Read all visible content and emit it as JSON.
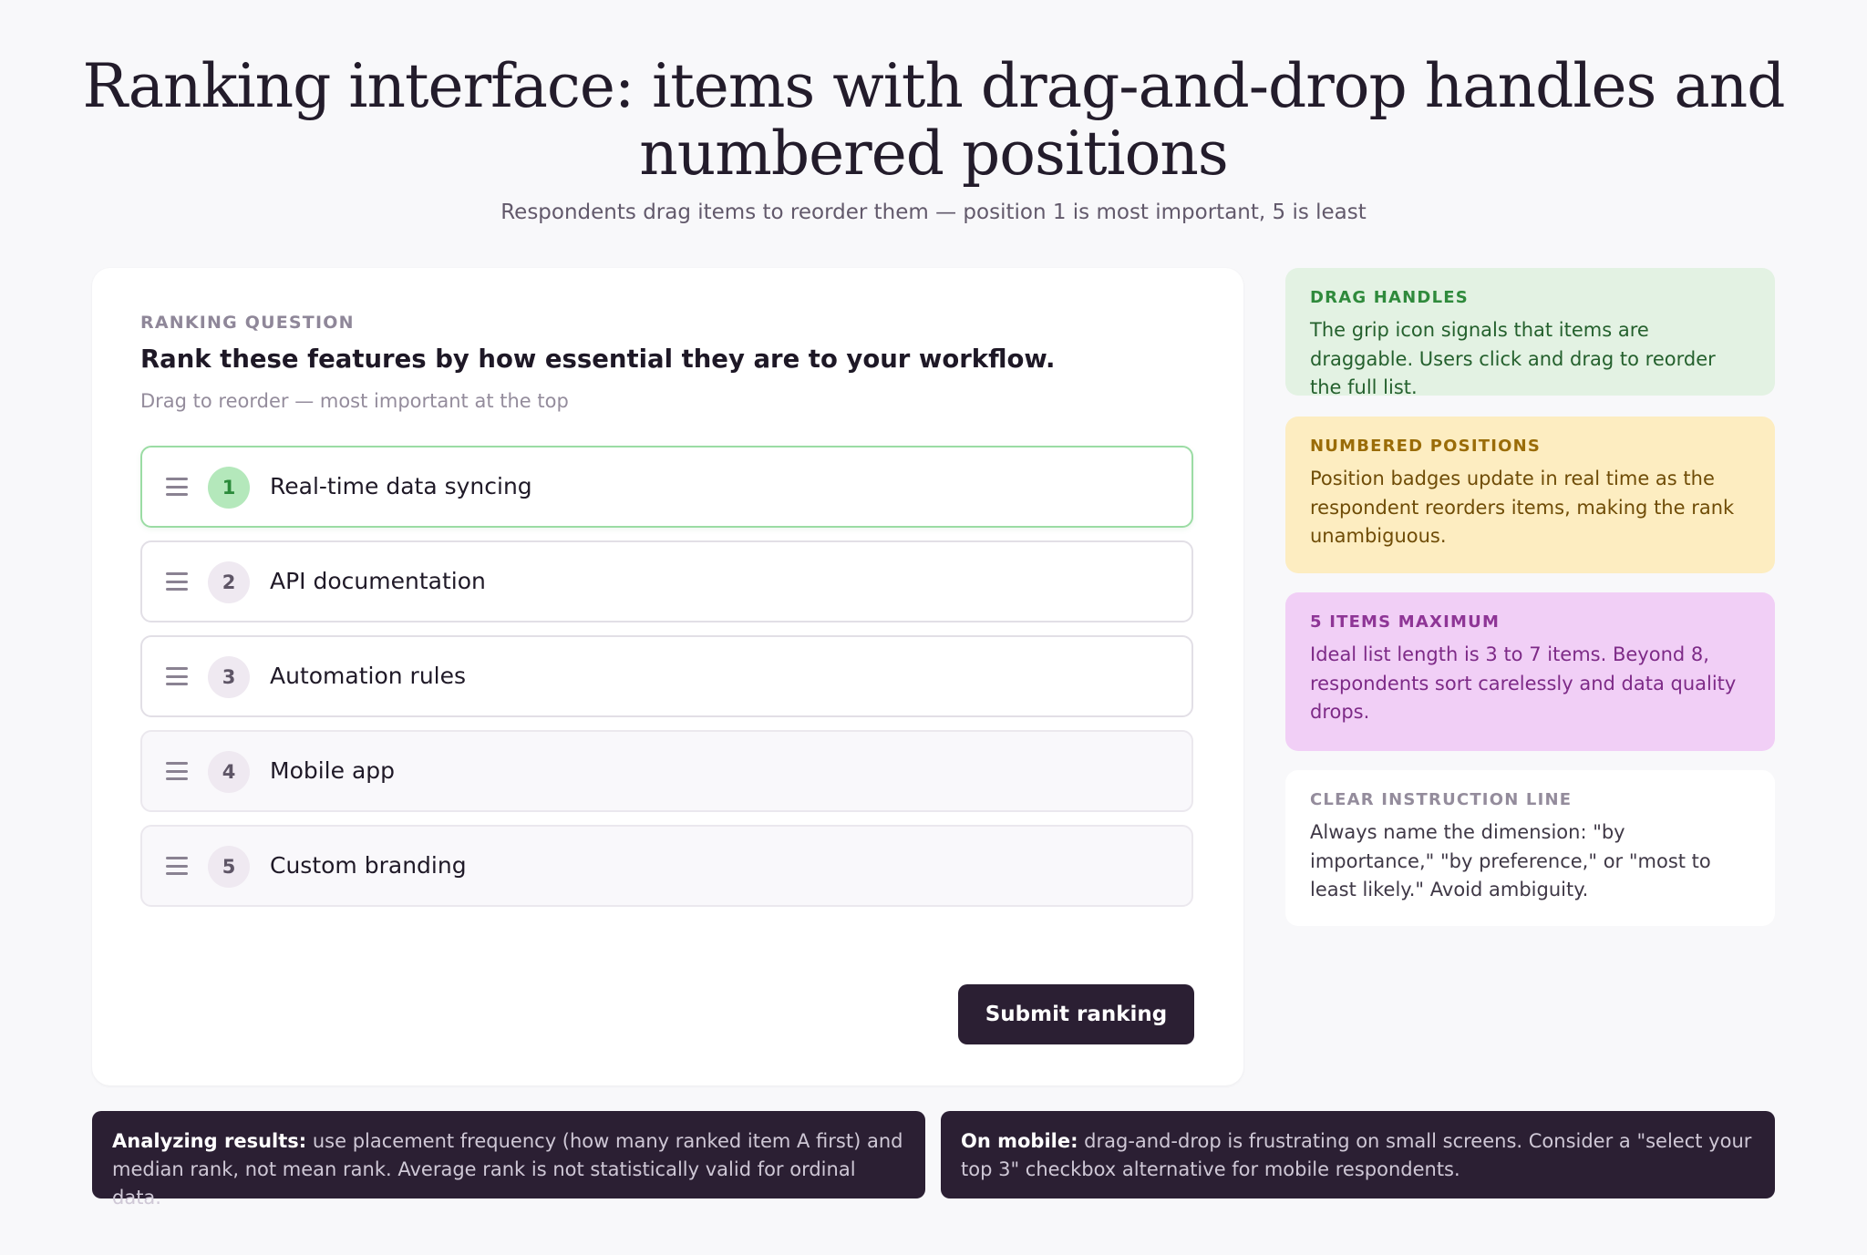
{
  "header": {
    "title": "Ranking interface: items with drag-and-drop handles and numbered positions",
    "subtitle": "Respondents drag items to reorder them — position 1 is most important, 5 is least"
  },
  "question": {
    "eyebrow": "RANKING QUESTION",
    "text": "Rank these features by how essential they are to your workflow.",
    "hint": "Drag to reorder — most important at the top",
    "items": [
      {
        "position": "1",
        "label": "Real-time data syncing"
      },
      {
        "position": "2",
        "label": "API documentation"
      },
      {
        "position": "3",
        "label": "Automation rules"
      },
      {
        "position": "4",
        "label": "Mobile app"
      },
      {
        "position": "5",
        "label": "Custom branding"
      }
    ],
    "icons": {
      "handle": "grip-lines-icon"
    },
    "submit_label": "Submit ranking"
  },
  "notes": [
    {
      "title": "DRAG HANDLES",
      "body": "The grip icon signals that items are draggable. Users click and drag to reorder the full list."
    },
    {
      "title": "NUMBERED POSITIONS",
      "body": "Position badges update in real time as the respondent reorders items, making the rank unambiguous."
    },
    {
      "title": "5 ITEMS MAXIMUM",
      "body": "Ideal list length is 3 to 7 items. Beyond 8, respondents sort carelessly and data quality drops."
    },
    {
      "title": "CLEAR INSTRUCTION LINE",
      "body": "Always name the dimension: \"by importance,\" \"by preference,\" or \"most to least likely.\" Avoid ambiguity."
    }
  ],
  "footer": {
    "left": {
      "lead": "Analyzing results:",
      "text": " use placement frequency (how many ranked item A first) and median rank, not mean rank. Average rank is not statistically valid for ordinal data."
    },
    "right": {
      "lead": "On mobile:",
      "text": " drag-and-drop is frustrating on small screens. Consider a \"select your top 3\" checkbox alternative for mobile respondents."
    }
  },
  "colors": {
    "accent_dark": "#2b1f33",
    "active_border": "#9bdca4",
    "active_badge": "#b4e8bb",
    "note_green": "#e3f2e3",
    "note_yellow": "#fdedc1",
    "note_pink": "#f1cff6"
  }
}
